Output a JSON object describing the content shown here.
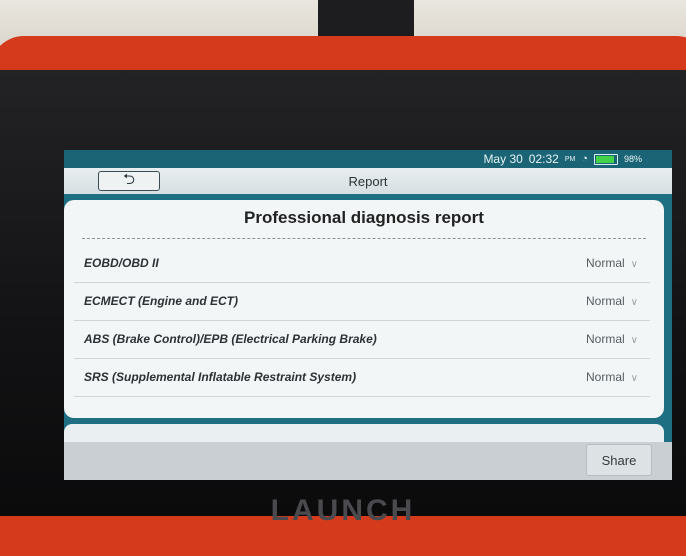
{
  "status": {
    "date": "May 30",
    "time": "02:32",
    "ampm": "PM",
    "battery": "98%"
  },
  "header": {
    "title": "Report"
  },
  "report": {
    "title": "Professional diagnosis report",
    "rows": [
      {
        "label": "EOBD/OBD II",
        "status": "Normal"
      },
      {
        "label": "ECMECT (Engine and ECT)",
        "status": "Normal"
      },
      {
        "label": "ABS (Brake Control)/EPB (Electrical Parking Brake)",
        "status": "Normal"
      },
      {
        "label": "SRS (Supplemental Inflatable Restraint System)",
        "status": "Normal"
      }
    ]
  },
  "footer": {
    "share_label": "Share"
  },
  "device": {
    "brand": "LAUNCH"
  },
  "icons": {
    "back": "back-arrow-icon",
    "wifi": "wifi-icon",
    "battery": "battery-icon",
    "chevron": "chevron-down-icon"
  },
  "colors": {
    "device_red": "#d63a1c",
    "screen_teal": "#1e6f82",
    "battery_green": "#43d14a"
  }
}
